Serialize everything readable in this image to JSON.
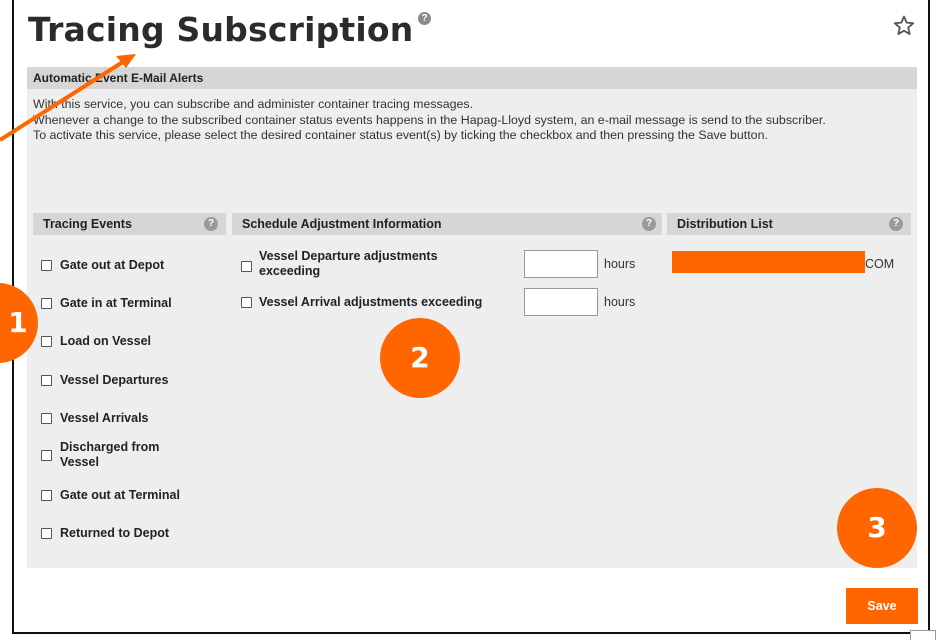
{
  "page": {
    "title": "Tracing Subscription",
    "help_glyph": "?",
    "favorite_icon": "star-outline-icon"
  },
  "panel": {
    "header": "Automatic Event E-Mail Alerts",
    "intro": [
      "With this service, you can subscribe and administer container tracing messages.",
      "Whenever a change to the subscribed container status events happens in the Hapag-Lloyd system, an e-mail message is send to the subscriber.",
      "To activate this service, please select the desired container status event(s) by ticking the checkbox and then pressing the Save button."
    ]
  },
  "tracing_events": {
    "header": "Tracing Events",
    "items": [
      {
        "label": "Gate out at Depot",
        "checked": false
      },
      {
        "label": "Gate in at Terminal",
        "checked": false
      },
      {
        "label": "Load on Vessel",
        "checked": false
      },
      {
        "label": "Vessel Departures",
        "checked": false
      },
      {
        "label": "Vessel Arrivals",
        "checked": false
      },
      {
        "label": "Discharged from Vessel",
        "checked": false
      },
      {
        "label": "Gate out at Terminal",
        "checked": false
      },
      {
        "label": "Returned to Depot",
        "checked": false
      }
    ]
  },
  "schedule": {
    "header": "Schedule Adjustment Information",
    "items": [
      {
        "label": "Vessel Departure adjustments exceeding",
        "value": "",
        "unit": "hours",
        "checked": false
      },
      {
        "label": "Vessel Arrival adjustments exceeding",
        "value": "",
        "unit": "hours",
        "checked": false
      }
    ]
  },
  "distribution": {
    "header": "Distribution List",
    "email_visible_suffix": "COM",
    "redaction_color": "#ff6600"
  },
  "actions": {
    "save_label": "Save"
  },
  "annotations": {
    "badge_1": "1",
    "badge_2": "2",
    "badge_3": "3",
    "accent_color": "#ff6600"
  }
}
